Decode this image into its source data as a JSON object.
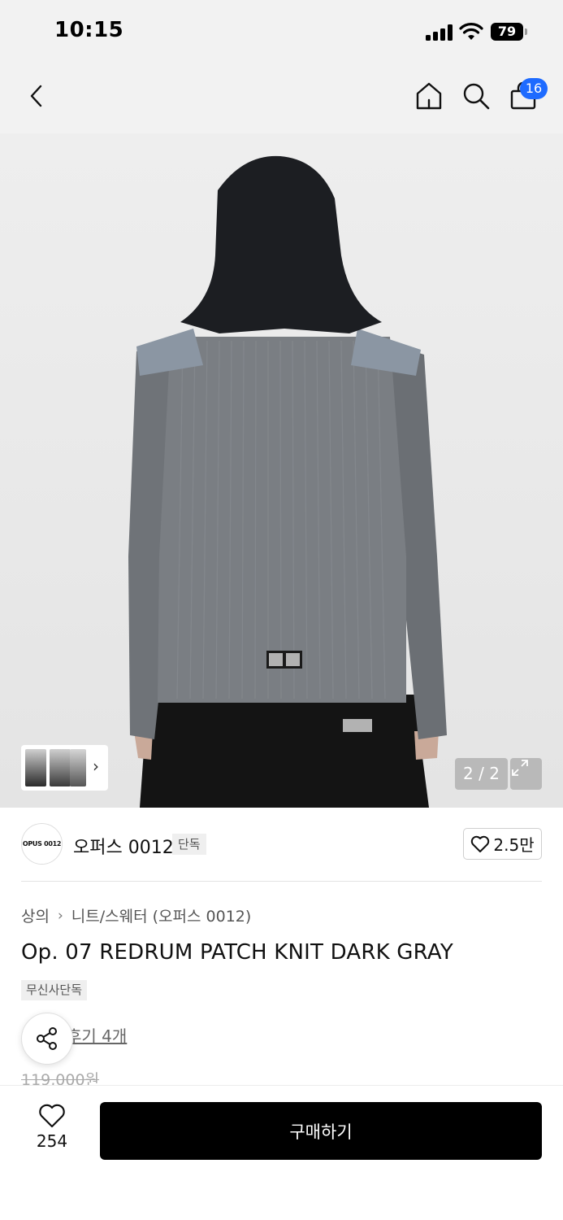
{
  "status_bar": {
    "time": "10:15",
    "battery": "79",
    "icons": [
      "signal-icon",
      "wifi-icon",
      "battery-icon"
    ]
  },
  "nav": {
    "icons": [
      "chevron-left-icon",
      "home-icon",
      "search-icon",
      "cart-icon"
    ],
    "cart_badge": "16",
    "accent_color": "#1e6bff"
  },
  "gallery": {
    "counter": "2 / 2",
    "thumbnail_count": 3,
    "expand_icon": "expand-icon"
  },
  "brand": {
    "logo_text": "OPUS 0012",
    "name": "오퍼스 0012",
    "tag": "단독",
    "like_count": "2.5만"
  },
  "product": {
    "breadcrumb": [
      "상의",
      "니트/스웨터 (오퍼스 0012)"
    ],
    "title": "Op. 07 REDRUM PATCH KNIT DARK GRAY",
    "exclusive_tag": "무신사단독",
    "review_link": "후기 4개",
    "original_price": "119,000원"
  },
  "bottom_bar": {
    "wish_count": "254",
    "buy_label": "구매하기"
  }
}
